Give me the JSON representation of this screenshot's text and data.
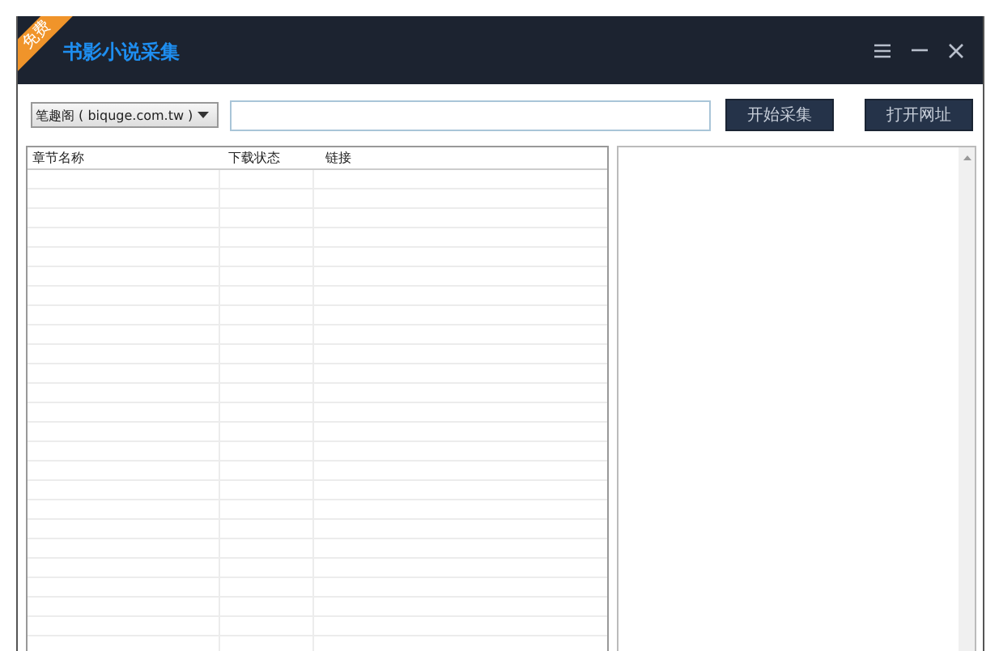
{
  "window": {
    "badge": "免费",
    "title": "书影小说采集"
  },
  "toolbar": {
    "source_select": {
      "value": "笔趣阁 ( biquge.com.tw )"
    },
    "buttons": [
      "开始采集",
      "打开网址"
    ]
  },
  "table": {
    "columns": [
      "章节名称",
      "下载状态",
      "链接"
    ]
  }
}
